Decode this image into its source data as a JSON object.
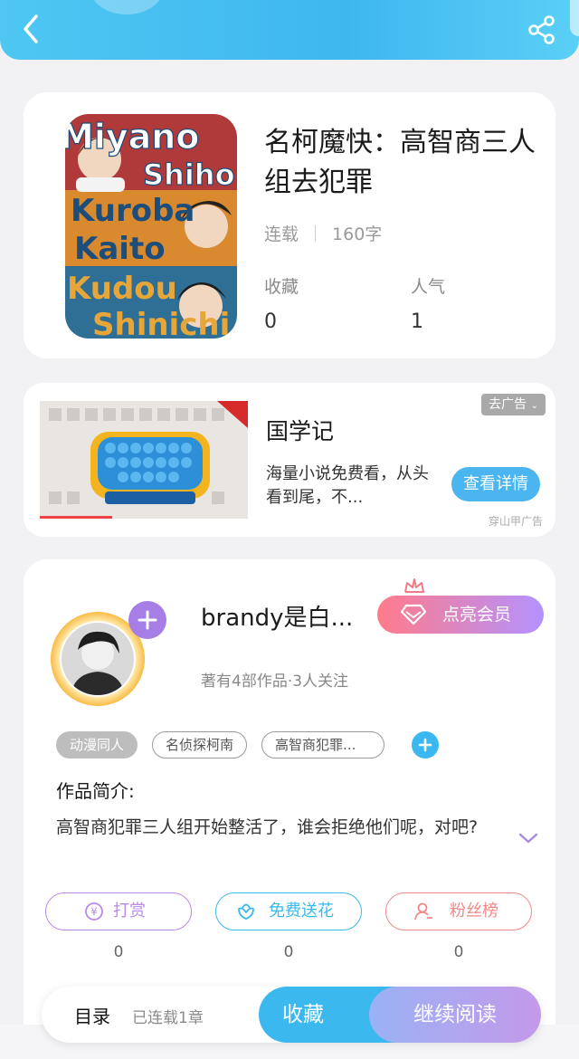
{
  "header": {
    "back_icon": "chevron-left-icon",
    "share_icon": "share-icon"
  },
  "book": {
    "title": "名柯魔快：高智商三人组去犯罪",
    "cover_texts": [
      "Miyano",
      "Shiho",
      "Kuroba",
      "Kaito",
      "Kudou",
      "Shinichi"
    ],
    "status": "连载",
    "word_count": "160字",
    "stats": [
      {
        "label": "收藏",
        "value": "0"
      },
      {
        "label": "人气",
        "value": "1"
      }
    ]
  },
  "ad": {
    "close_label": "去广告",
    "title": "国学记",
    "desc": "海量小说免费看，从头看到尾，不...",
    "button": "查看详情",
    "source": "穿山甲广告"
  },
  "author": {
    "name": "brandy是白...",
    "vip_label": "点亮会员",
    "stats": "著有4部作品·3人关注",
    "tags": [
      "动漫同人",
      "名侦探柯南",
      "高智商犯罪..."
    ],
    "intro_heading": "作品简介:",
    "intro_text": "高智商犯罪三人组开始整活了，谁会拒绝他们呢，对吧?",
    "actions": [
      {
        "label": "打赏",
        "count": "0",
        "icon": "yen-coin-icon",
        "color": "#b98ae8"
      },
      {
        "label": "免费送花",
        "count": "0",
        "icon": "flower-icon",
        "color": "#39b9ec"
      },
      {
        "label": "粉丝榜",
        "count": "0",
        "icon": "fans-user-icon",
        "color": "#ef8a8a"
      }
    ]
  },
  "bottom_bar": {
    "toc_label": "目录",
    "chapter_status": "已连载1章",
    "collect_label": "收藏",
    "read_label": "继续阅读"
  }
}
